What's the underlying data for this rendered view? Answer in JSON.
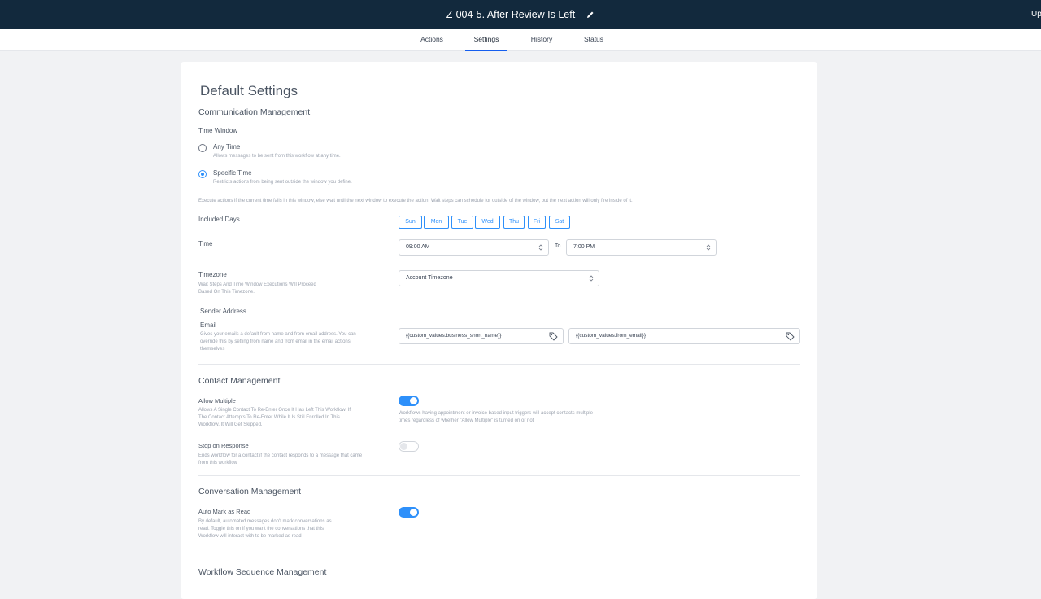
{
  "header": {
    "title": "Z-004-5. After Review Is Left",
    "right_label": "Up"
  },
  "tabs": [
    {
      "label": "Actions"
    },
    {
      "label": "Settings"
    },
    {
      "label": "History"
    },
    {
      "label": "Status"
    }
  ],
  "active_tab": "Settings",
  "page": {
    "title": "Default Settings",
    "communication": {
      "heading": "Communication Management",
      "time_window_label": "Time Window",
      "any_time": {
        "label": "Any Time",
        "desc": "Allows messages to be sent from this workflow at any time.",
        "selected": false
      },
      "specific_time": {
        "label": "Specific Time",
        "desc": "Restricts actions from being sent outside the window you define.",
        "selected": true
      },
      "execute_note": "Execute actions if the current time falls in this window, else wait until the next window to execute the action. Wait steps can schedule for outside of the window, but the next action will only fire inside of it.",
      "included_days_label": "Included Days",
      "days": [
        "Sun",
        "Mon",
        "Tue",
        "Wed",
        "Thu",
        "Fri",
        "Sat"
      ],
      "time_label": "Time",
      "time_from": "09:00 AM",
      "to_label": "To",
      "time_to": "7:00 PM",
      "timezone_label": "Timezone",
      "timezone_desc": "Wait Steps And Time Window Executions Will Proceed Based On This Timezone.",
      "timezone_value": "Account Timezone",
      "sender_address_label": "Sender Address",
      "email_label": "Email",
      "email_desc": "Gives your emails a default from name and from email address. You can override this by setting from name and from email in the email actions themselves",
      "from_name_value": "{{custom_values.business_short_name}}",
      "from_email_value": "{{custom_values.from_email}}"
    },
    "contact": {
      "heading": "Contact Management",
      "allow_multiple_label": "Allow Multiple",
      "allow_multiple_desc": "Allows A Single Contact To Re-Enter Once It Has Left This Workflow. If The Contact Attempts To Re-Enter While It Is Still Enrolled In This Workflow, It Will Get Skipped.",
      "allow_multiple_on": true,
      "allow_multiple_note": "Workflows having appointment or invoice based input triggers will accept contacts multiple times regardless of whether \"Allow Multiple\" is turned on or not",
      "stop_on_response_label": "Stop on Response",
      "stop_on_response_desc": "Ends workflow for a contact if the contact responds to a message that came from this workflow",
      "stop_on_response_on": false
    },
    "conversation": {
      "heading": "Conversation Management",
      "auto_mark_label": "Auto Mark as Read",
      "auto_mark_desc": "By default, automated messages don't mark conversations as read. Toggle this on if you want the conversations that this Workflow will interact with to be marked as read",
      "auto_mark_on": true
    },
    "sequence": {
      "heading": "Workflow Sequence Management"
    }
  },
  "colors": {
    "header_bg": "#12293d",
    "accent": "#2e90fa",
    "tab_active": "#155eef"
  }
}
